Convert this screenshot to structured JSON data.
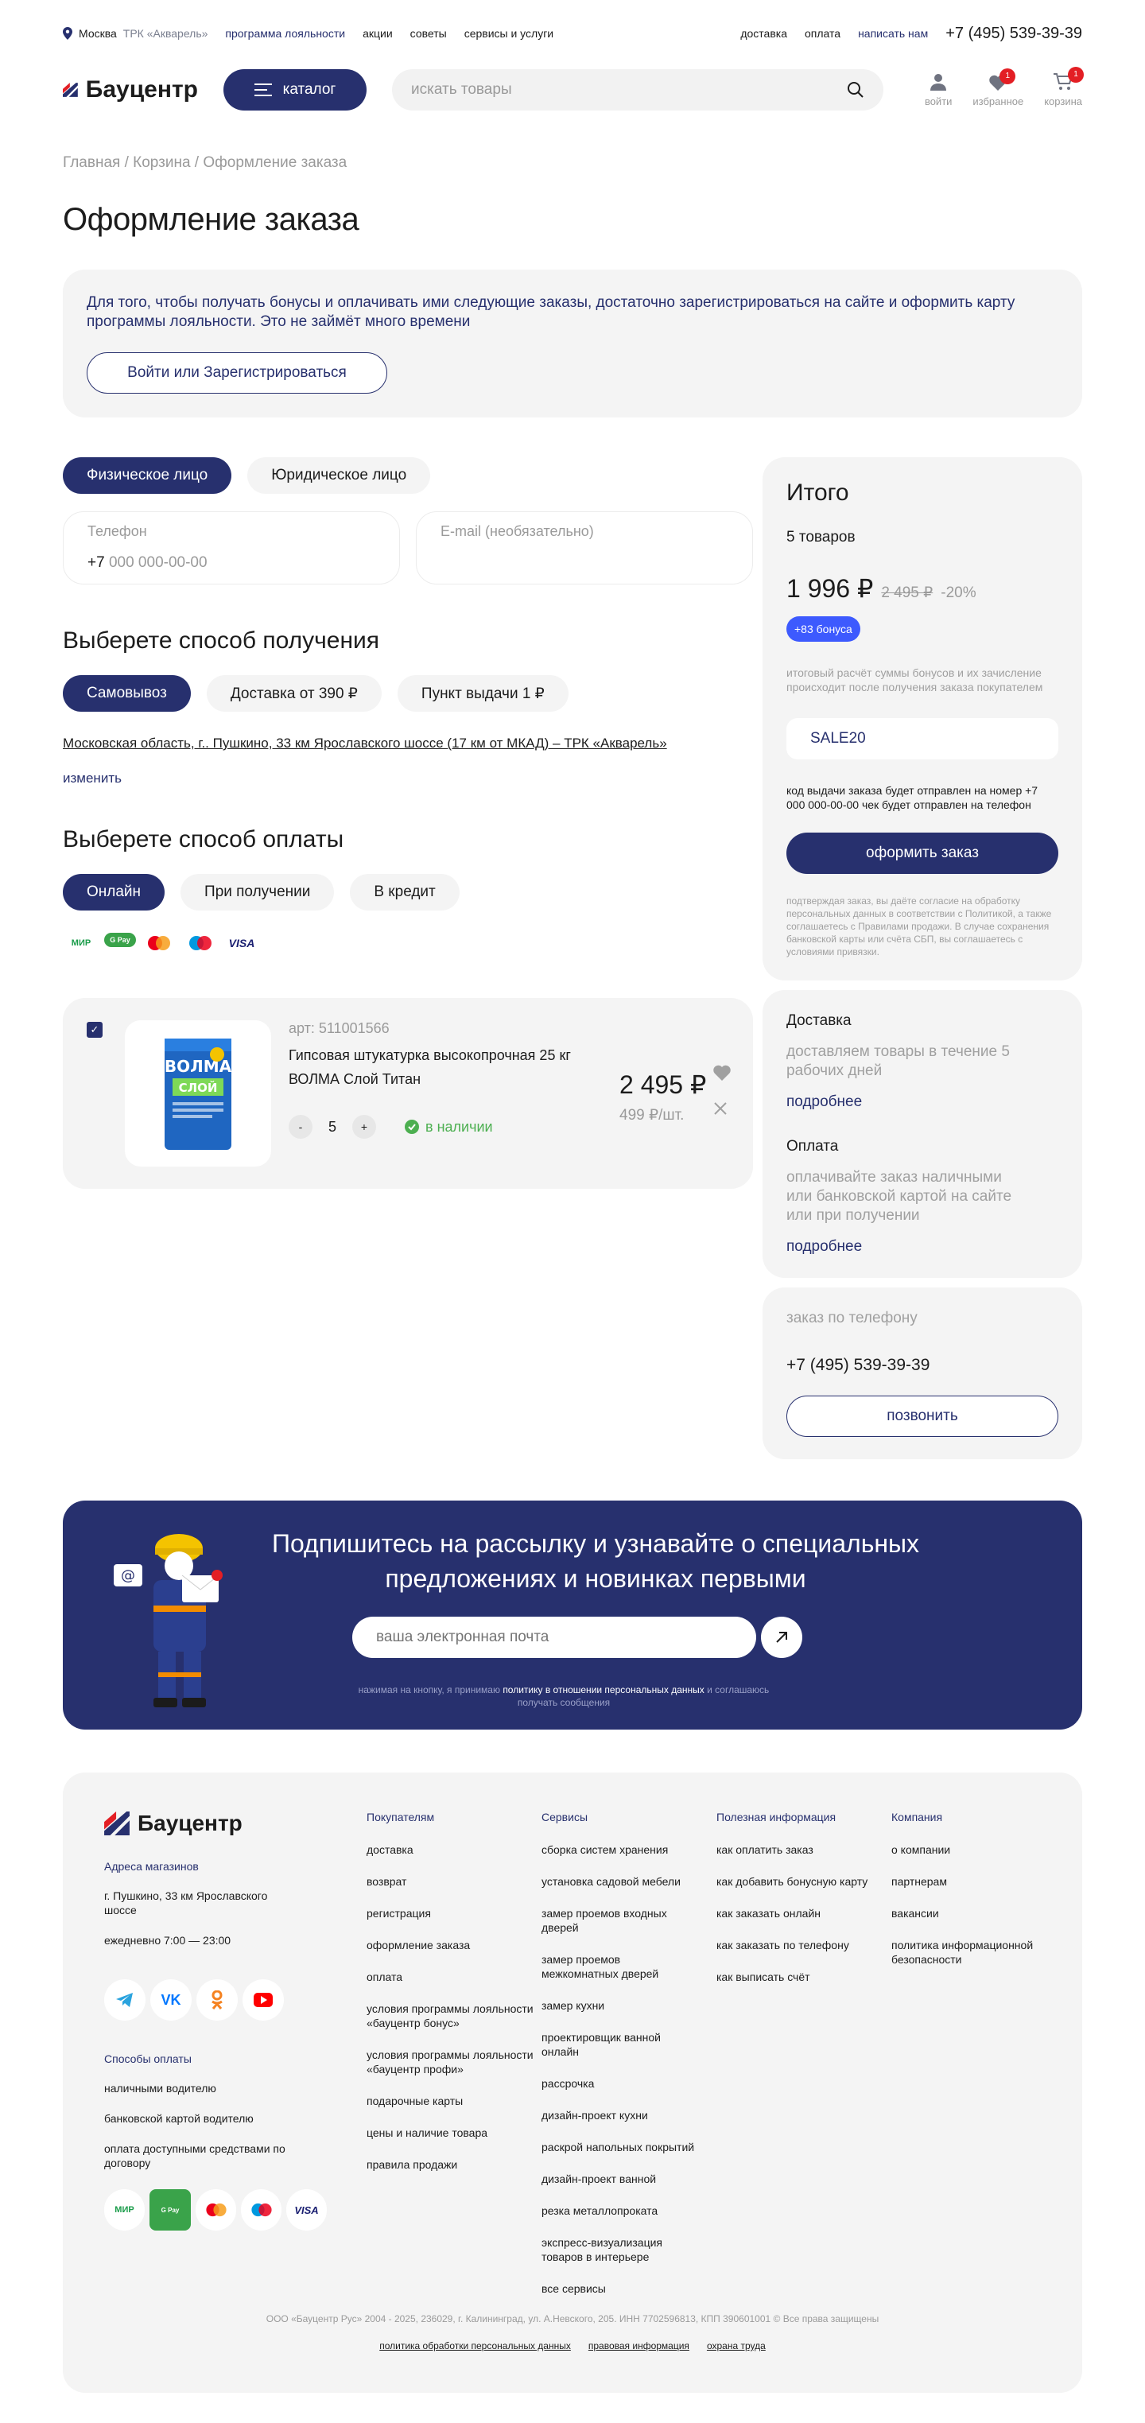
{
  "topbar": {
    "city": "Москва",
    "store": "ТРК «Акварель»",
    "nav": [
      "программа лояльности",
      "акции",
      "советы",
      "сервисы и услуги"
    ],
    "right": [
      "доставка",
      "оплата",
      "написать нам"
    ],
    "phone": "+7 (495) 539-39-39"
  },
  "header": {
    "logo": "Бауцентр",
    "catalog": "каталог",
    "search_placeholder": "искать товары",
    "login": "войти",
    "favorites": "избранное",
    "favorites_count": "1",
    "cart": "корзина",
    "cart_count": "1"
  },
  "breadcrumbs": "Главная / Корзина / Оформление заказа",
  "page_title": "Оформление заказа",
  "notice": {
    "text": "Для того, чтобы получать бонусы и оплачивать ими следующие заказы, достаточно зарегистрироваться на сайте и оформить карту программы лояльности. Это не займёт много времени",
    "button": "Войти или Зарегистрироваться"
  },
  "buyer_type": [
    "Физическое лицо",
    "Юридическое лицо"
  ],
  "phone_field": {
    "label": "Телефон",
    "prefix": "+7",
    "placeholder": "000 000-00-00"
  },
  "email_field": {
    "label": "E-mail (необязательно)"
  },
  "delivery": {
    "title": "Выберете способ получения",
    "options": [
      "Самовывоз",
      "Доставка от 390 ₽",
      "Пункт выдачи 1 ₽"
    ],
    "address": "Московская область, г.. Пушкино, 33 км Ярославского шоссе (17 км от МКАД) – ТРК «Акварель»",
    "change": "изменить"
  },
  "payment": {
    "title": "Выберете способ оплаты",
    "options": [
      "Онлайн",
      "При получении",
      "В кредит"
    ],
    "icons": [
      "МИР",
      "G Pay",
      "MC",
      "Maestro",
      "VISA"
    ]
  },
  "product": {
    "sku": "арт: 511001566",
    "name": "Гипсовая штукатурка высокопрочная 25 кг ВОЛМА Слой Титан",
    "qty": "5",
    "stock": "в наличии",
    "price": "2 495 ₽",
    "unit_price": "499 ₽/шт."
  },
  "summary": {
    "title": "Итого",
    "count": "5 товаров",
    "total": "1 996 ₽",
    "old": "2 495 ₽",
    "discount": "-20%",
    "bonus": "+83 бонуса",
    "bonus_note": "итоговый расчёт суммы бонусов и их зачисление происходит после получения заказа покупателем",
    "promo": "SALE20",
    "code_info": "код выдачи заказа будет отправлен на номер +7 000 000-00-00 чек будет отправлен на телефон",
    "submit": "оформить заказ",
    "legal": "подтверждая заказ, вы даёте согласие на обработку персональных данных в соответствии с Политикой, а также соглашаетесь с Правилами продажи. В случае сохранения банковской карты или счёта СБП, вы соглашаетесь с условиями привязки."
  },
  "info": {
    "delivery_title": "Доставка",
    "delivery_text": "доставляем товары в течение 5 рабочих дней",
    "more": "подробнее",
    "payment_title": "Оплата",
    "payment_text": "оплачивайте заказ наличными или банковской картой на сайте или при получении"
  },
  "call": {
    "title": "заказ по телефону",
    "phone": "+7 (495) 539-39-39",
    "button": "позвонить"
  },
  "subscribe": {
    "title": "Подпишитесь на рассылку и узнавайте о специальных предложениях и новинках первыми",
    "placeholder": "ваша электронная почта",
    "legal_a": "нажимая на кнопку, я принимаю",
    "legal_b": "политику в отношении персональных данных",
    "legal_c": "и соглашаюсь получать сообщения"
  },
  "footer": {
    "logo": "Бауцентр",
    "stores_label": "Адреса магазинов",
    "store_address": "г. Пушкино, 33 км Ярославского шоссе",
    "hours": "ежедневно 7:00 — 23:00",
    "pay_label": "Способы оплаты",
    "pay_items": [
      "наличными водителю",
      "банковской картой водителю",
      "оплата доступными средствами по договору"
    ],
    "cols": [
      {
        "title": "Покупателям",
        "items": [
          "доставка",
          "возврат",
          "регистрация",
          "оформление заказа",
          "оплата",
          "условия программы лояльности «бауцентр бонус»",
          "условия программы лояльности «бауцентр профи»",
          "подарочные карты",
          "цены и наличие товара",
          "правила продажи"
        ]
      },
      {
        "title": "Сервисы",
        "items": [
          "сборка систем хранения",
          "установка садовой мебели",
          "замер проемов входных дверей",
          "замер проемов межкомнатных дверей",
          "замер кухни",
          "проектировщик ванной онлайн",
          "рассрочка",
          "дизайн-проект кухни",
          "раскрой напольных покрытий",
          "дизайн-проект ванной",
          "резка металлопроката",
          "экспресс-визуализация товаров в интерьере",
          "все сервисы"
        ]
      },
      {
        "title": "Полезная информация",
        "items": [
          "как оплатить заказ",
          "как добавить бонусную карту",
          "как заказать онлайн",
          "как заказать по телефону",
          "как выписать счёт"
        ]
      },
      {
        "title": "Компания",
        "items": [
          "о компании",
          "партнерам",
          "вакансии",
          "политика информационной безопасности"
        ]
      }
    ],
    "copyright": "ООО «Бауцентр Рус» 2004 - 2025, 236029, г. Калининград, ул. А.Невского, 205. ИНН 7702596813, КПП 390601001 © Все права защищены",
    "links": [
      "политика обработки персональных данных",
      "правовая информация",
      "охрана труда"
    ]
  },
  "colors": {
    "brand_navy": "#27306e",
    "accent_red": "#e31e24",
    "bonus_blue": "#3d5afe",
    "stock_green": "#4caf50"
  }
}
